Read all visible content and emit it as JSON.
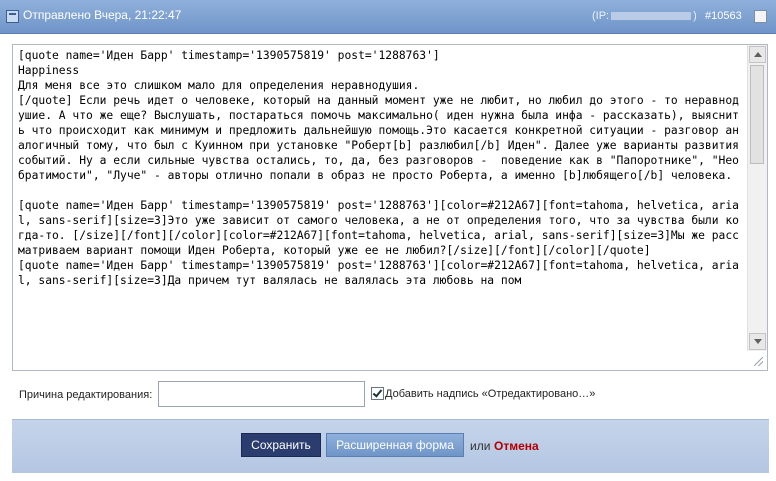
{
  "header": {
    "title": "Отправлено Вчера, 21:22:47",
    "ip_label": "(IP:",
    "ip_close": ")",
    "post_number": "#10563"
  },
  "editor": {
    "text": "[quote name='Иден Барр' timestamp='1390575819' post='1288763']\nHappiness\nДля меня все это слишком мало для определения неравнодушия.\n[/quote] Если речь идет о человеке, который на данный момент уже не любит, но любил до этого - то неравнодушие. А что же еще? Выслушать, постараться помочь максимально( иден нужна была инфа - рассказать), выяснить что происходит как минимум и предложить дальнейшую помощь.Это касается конкретной ситуации - разговор аналогичный тому, что был с Куинном при установке \"Роберт[b] разлюбил[/b] Иден\". Далее уже варианты развития событий. Ну а если сильные чувства остались, то, да, без разговоров -  поведение как в \"Папоротнике\", \"Необратимости\", \"Луче\" - авторы отлично попали в образ не просто Роберта, а именно [b]любящего[/b] человека.\n\n[quote name='Иден Барр' timestamp='1390575819' post='1288763'][color=#212A67][font=tahoma, helvetica, arial, sans-serif][size=3]Это уже зависит от самого человека, а не от определения того, что за чувства были когда-то. [/size][/font][/color][color=#212A67][font=tahoma, helvetica, arial, sans-serif][size=3]Мы же рассматриваем вариант помощи Иден Роберта, который уже ее не любил?[/size][/font][/color][/quote]\n[quote name='Иден Барр' timestamp='1390575819' post='1288763'][color=#212A67][font=tahoma, helvetica, arial, sans-serif][size=3]Да причем тут валялась не валялась эта любовь на пом"
  },
  "form": {
    "reason_label": "Причина редактирования:",
    "reason_value": "",
    "append_label": "Добавить надпись «Отредактировано…»",
    "append_checked": true
  },
  "buttons": {
    "save": "Сохранить",
    "advanced": "Расширенная форма",
    "or": "или",
    "cancel": "Отмена"
  }
}
